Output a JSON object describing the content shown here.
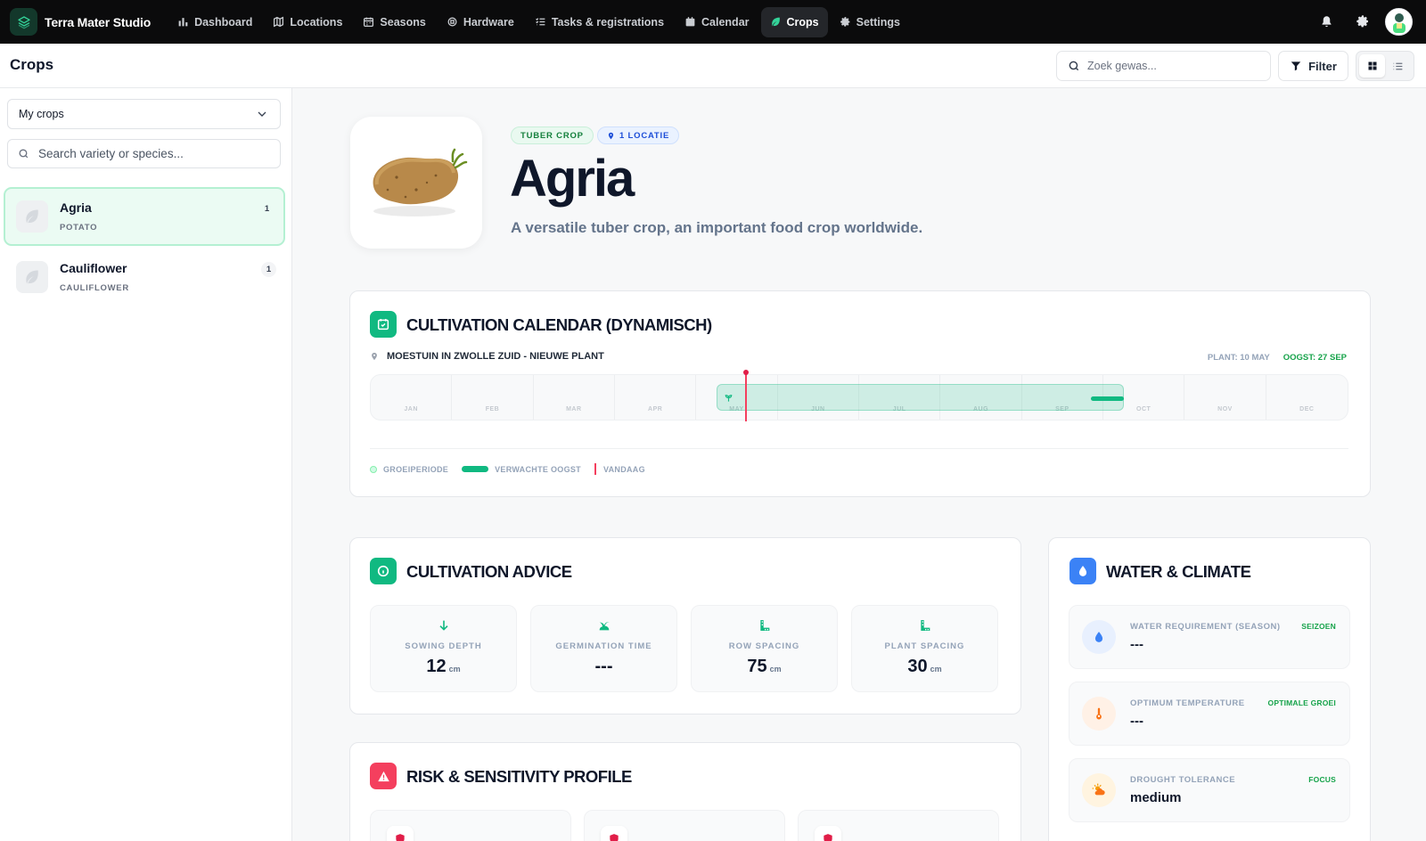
{
  "app": {
    "name": "Terra Mater Studio"
  },
  "nav": {
    "items": [
      {
        "label": "Dashboard",
        "icon": "bar-chart-icon"
      },
      {
        "label": "Locations",
        "icon": "map-icon"
      },
      {
        "label": "Seasons",
        "icon": "calendar-grid-icon"
      },
      {
        "label": "Hardware",
        "icon": "chip-icon"
      },
      {
        "label": "Tasks & registrations",
        "icon": "list-check-icon"
      },
      {
        "label": "Calendar",
        "icon": "calendar-icon"
      },
      {
        "label": "Crops",
        "icon": "leaf-icon",
        "active": true
      },
      {
        "label": "Settings",
        "icon": "gear-icon"
      }
    ]
  },
  "header": {
    "title": "Crops",
    "search_placeholder": "Zoek gewas...",
    "filter_label": "Filter"
  },
  "sidebar": {
    "select_value": "My crops",
    "search_placeholder": "Search variety or species...",
    "crops": [
      {
        "name": "Agria",
        "species": "POTATO",
        "count": "1",
        "active": true
      },
      {
        "name": "Cauliflower",
        "species": "CAULIFLOWER",
        "count": "1",
        "active": false
      }
    ]
  },
  "hero": {
    "badge_type": "TUBER CROP",
    "badge_location": "1 LOCATIE",
    "title": "Agria",
    "subtitle": "A versatile tuber crop, an important food crop worldwide."
  },
  "calendar": {
    "title": "CULTIVATION CALENDAR (DYNAMISCH)",
    "location": "MOESTUIN IN ZWOLLE ZUID - NIEUWE PLANT",
    "plant_date": "PLANT: 10 MAY",
    "harvest_date": "OOGST: 27 SEP",
    "months": [
      "JAN",
      "FEB",
      "MAR",
      "APR",
      "MAY",
      "JUN",
      "JUL",
      "AUG",
      "SEP",
      "OCT",
      "NOV",
      "DEC"
    ],
    "grow_period": {
      "start_month": 4.25,
      "end_month": 9.25
    },
    "expected_harvest": {
      "start_month": 8.85,
      "end_month": 9.25
    },
    "today_month": 4.6,
    "legend": {
      "grow": "GROEIPERIODE",
      "harvest": "VERWACHTE OOGST",
      "today": "VANDAAG"
    },
    "colors": {
      "grow": "#10b981",
      "today": "#f43f5e"
    }
  },
  "advice": {
    "title": "CULTIVATION ADVICE",
    "stats": [
      {
        "label": "SOWING DEPTH",
        "value": "12",
        "unit": "cm",
        "icon": "arrow-down-icon"
      },
      {
        "label": "GERMINATION TIME",
        "value": "---",
        "unit": "",
        "icon": "sprout-icon"
      },
      {
        "label": "ROW SPACING",
        "value": "75",
        "unit": "cm",
        "icon": "ruler-icon"
      },
      {
        "label": "PLANT SPACING",
        "value": "30",
        "unit": "cm",
        "icon": "ruler-icon"
      }
    ]
  },
  "water": {
    "title": "WATER & CLIMATE",
    "rows": [
      {
        "label": "WATER REQUIREMENT (SEASON)",
        "value": "---",
        "tag": "SEIZOEN",
        "icon": "droplet-icon"
      },
      {
        "label": "OPTIMUM TEMPERATURE",
        "value": "---",
        "tag": "OPTIMALE GROEI",
        "icon": "thermometer-icon"
      },
      {
        "label": "DROUGHT TOLERANCE",
        "value": "medium",
        "tag": "FOCUS",
        "icon": "sun-cloud-icon"
      }
    ]
  },
  "risk": {
    "title": "RISK & SENSITIVITY PROFILE"
  }
}
